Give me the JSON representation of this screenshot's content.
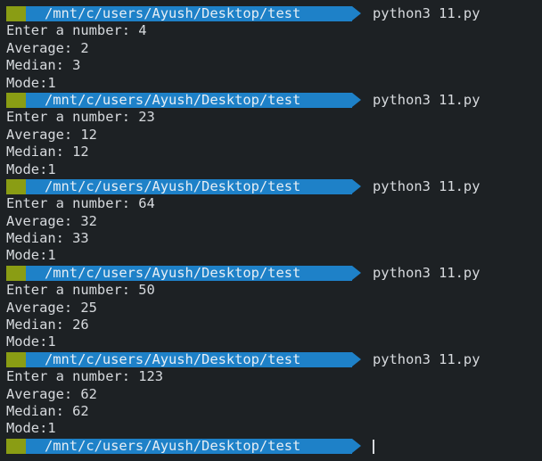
{
  "terminal": {
    "prompt_path": "/mnt/c/users/Ayush/Desktop/test",
    "command": "python3 11.py",
    "runs": [
      {
        "input_line": "Enter a number: 4",
        "average": "Average: 2",
        "median": "Median: 3",
        "mode": "Mode:1"
      },
      {
        "input_line": "Enter a number: 23",
        "average": "Average: 12",
        "median": "Median: 12",
        "mode": "Mode:1"
      },
      {
        "input_line": "Enter a number: 64",
        "average": "Average: 32",
        "median": "Median: 33",
        "mode": "Mode:1"
      },
      {
        "input_line": "Enter a number: 50",
        "average": "Average: 25",
        "median": "Median: 26",
        "mode": "Mode:1"
      },
      {
        "input_line": "Enter a number: 123",
        "average": "Average: 62",
        "median": "Median: 62",
        "mode": "Mode:1"
      }
    ]
  },
  "colors": {
    "background": "#1d2124",
    "prompt_green": "#8a9d14",
    "prompt_blue": "#1e81c8",
    "text": "#d7dade"
  }
}
